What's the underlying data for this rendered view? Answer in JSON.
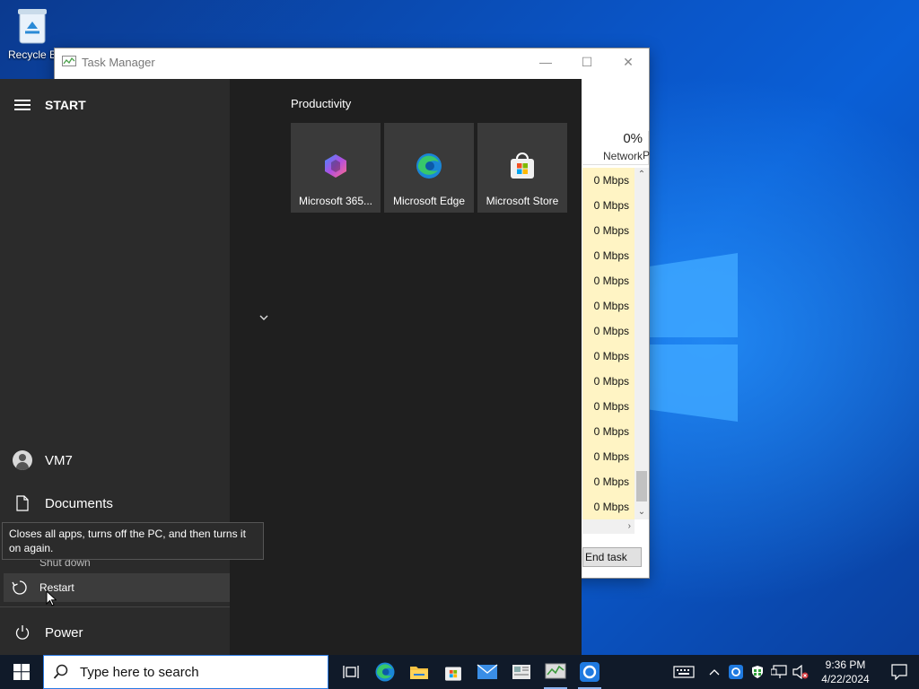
{
  "desktop": {
    "recycle_bin_label": "Recycle B"
  },
  "task_manager": {
    "title": "Task Manager",
    "network_percent": "0%",
    "network_label": "Network",
    "next_col_label": "P",
    "rows": [
      "0 Mbps",
      "0 Mbps",
      "0 Mbps",
      "0 Mbps",
      "0 Mbps",
      "0 Mbps",
      "0 Mbps",
      "0 Mbps",
      "0 Mbps",
      "0 Mbps",
      "0 Mbps",
      "0 Mbps",
      "0 Mbps",
      "0 Mbps"
    ],
    "end_task_label": "End task"
  },
  "start_menu": {
    "header": "START",
    "user_name": "VM7",
    "documents_label": "Documents",
    "shutdown_peek": "Shut down",
    "restart_label": "Restart",
    "power_label": "Power",
    "tooltip": "Closes all apps, turns off the PC, and then turns it on again.",
    "section_title": "Productivity",
    "tiles": [
      {
        "label": "Microsoft 365...",
        "icon": "microsoft-365-icon"
      },
      {
        "label": "Microsoft Edge",
        "icon": "edge-icon"
      },
      {
        "label": "Microsoft Store",
        "icon": "store-icon"
      }
    ]
  },
  "taskbar": {
    "search_placeholder": "Type here to search",
    "time": "9:36 PM",
    "date": "4/22/2024"
  }
}
